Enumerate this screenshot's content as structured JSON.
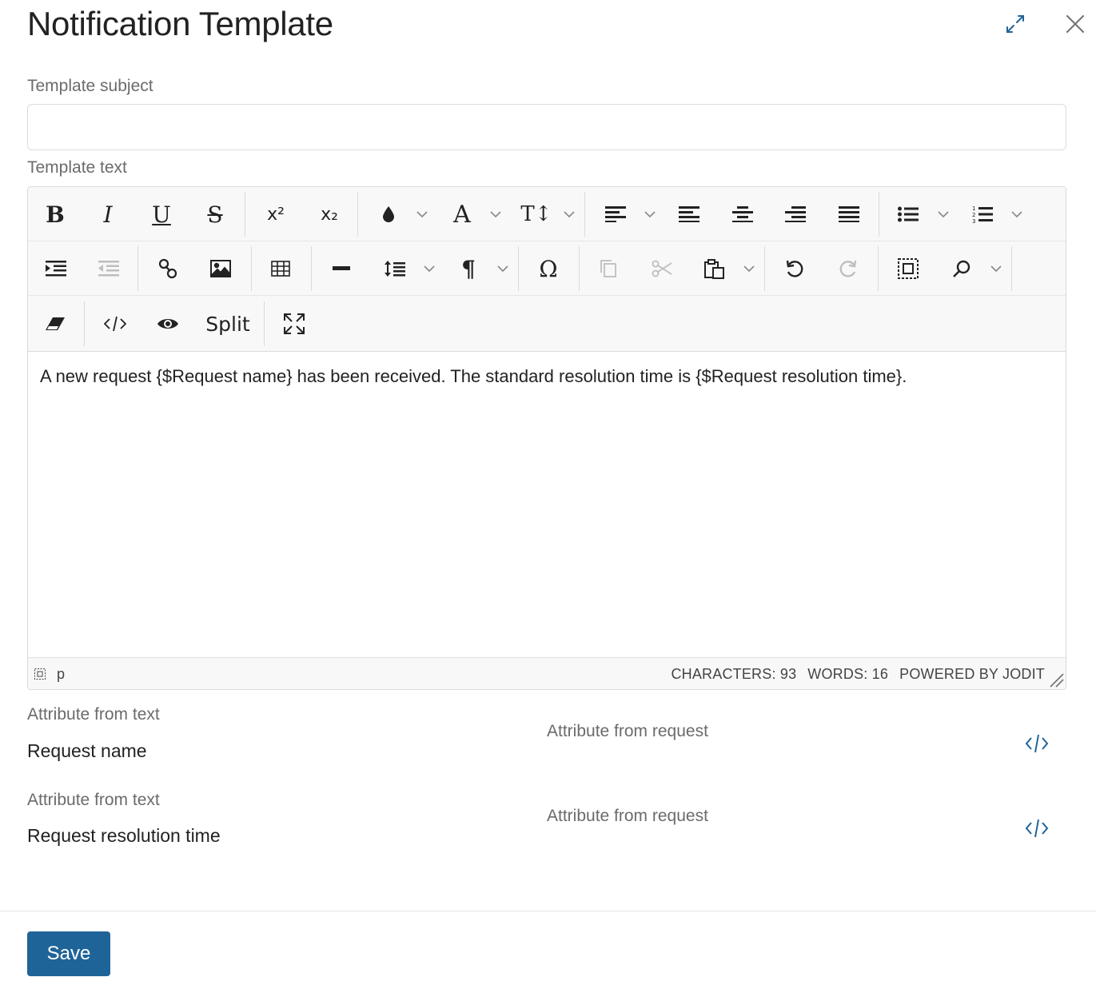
{
  "header": {
    "title": "Notification Template",
    "expand_icon": "expand-icon",
    "close_icon": "close-icon",
    "accent_color": "#1f6499"
  },
  "form": {
    "subject_label": "Template subject",
    "subject_value": "",
    "text_label": "Template text"
  },
  "editor": {
    "toolbar": {
      "bold": "B",
      "italic": "I",
      "underline": "U",
      "strikethrough": "S",
      "superscript": "x²",
      "subscript": "x₂",
      "font": "A",
      "font_size": "T↕",
      "paragraph": "¶",
      "symbol": "Ω",
      "split": "Split"
    },
    "content": "A new request {$Request name} has been received. The standard resolution time is {$Request resolution time}.",
    "status": {
      "path_tag": "p",
      "characters": "CHARACTERS: 93",
      "words": "WORDS: 16",
      "powered_by": "POWERED BY JODIT"
    }
  },
  "attributes": [
    {
      "text_label": "Attribute from text",
      "text_value": "Request name",
      "request_label": "Attribute from request"
    },
    {
      "text_label": "Attribute from text",
      "text_value": "Request resolution time",
      "request_label": "Attribute from request"
    }
  ],
  "footer": {
    "save_label": "Save"
  }
}
